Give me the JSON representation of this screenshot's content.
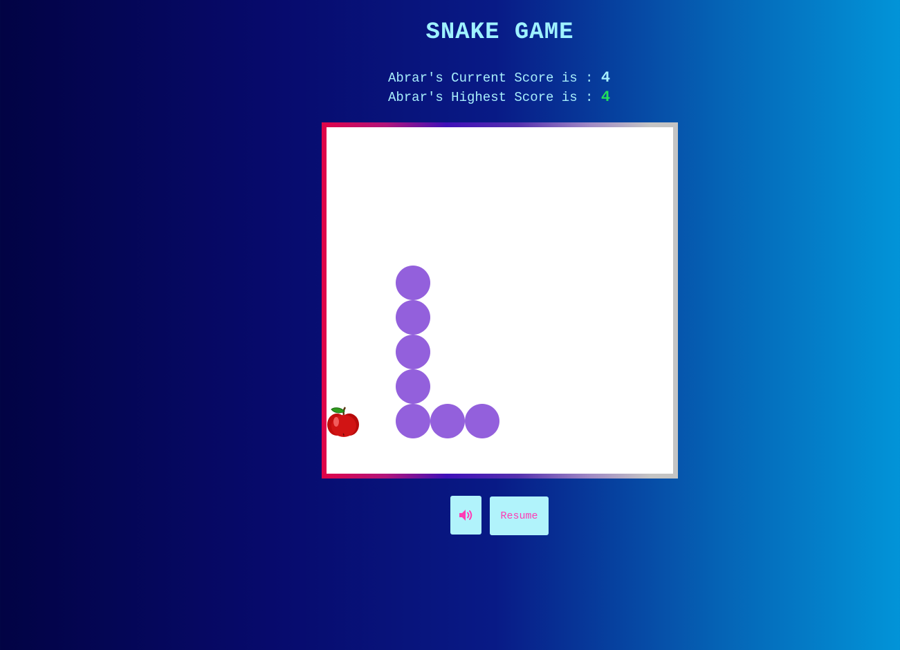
{
  "game": {
    "title": "SNAKE GAME",
    "current_score_label": "Abrar's Current Score is : ",
    "current_score": "4",
    "highest_score_label": "Abrar's Highest Score is : ",
    "highest_score": "4",
    "board": {
      "cols": 10,
      "rows": 10,
      "snake": [
        {
          "col": 2,
          "row": 4
        },
        {
          "col": 2,
          "row": 5
        },
        {
          "col": 2,
          "row": 6
        },
        {
          "col": 2,
          "row": 7
        },
        {
          "col": 2,
          "row": 8
        },
        {
          "col": 3,
          "row": 8
        },
        {
          "col": 4,
          "row": 8
        }
      ],
      "food": {
        "col": 0,
        "row": 8,
        "icon": "apple-icon"
      },
      "snake_color": "#9360dc"
    }
  },
  "controls": {
    "sound_icon": "speaker-volume-icon",
    "resume_label": "Resume"
  },
  "colors": {
    "title": "#9ff2ff",
    "highest_score": "#22e05a",
    "button_bg": "#b1f3fb",
    "button_text": "#ff3bb4"
  }
}
